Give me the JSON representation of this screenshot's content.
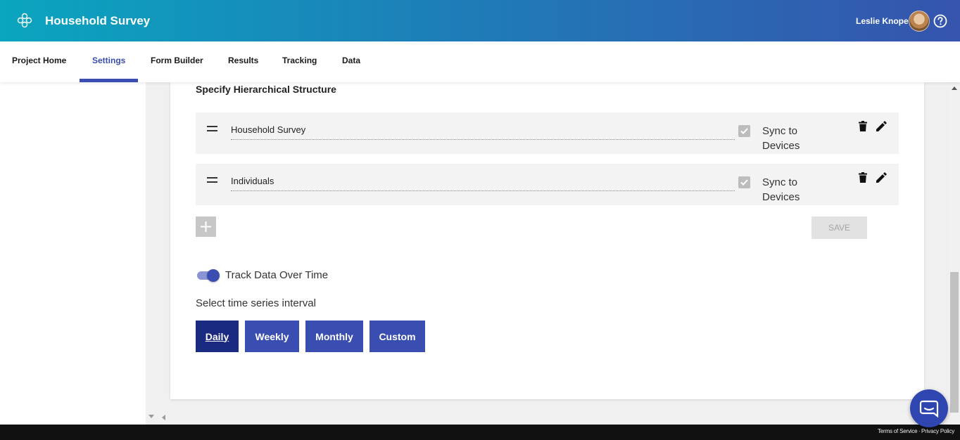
{
  "header": {
    "app_title": "Household Survey",
    "user_name": "Leslie Knope",
    "logo_icon": "flower-logo-icon",
    "help_icon": "question-circle-icon"
  },
  "nav": {
    "tabs": [
      {
        "label": "Project Home",
        "active": false
      },
      {
        "label": "Settings",
        "active": true
      },
      {
        "label": "Form Builder",
        "active": false
      },
      {
        "label": "Results",
        "active": false
      },
      {
        "label": "Tracking",
        "active": false
      },
      {
        "label": "Data",
        "active": false
      }
    ]
  },
  "hierarchy": {
    "title": "Specify Hierarchical Structure",
    "rows": [
      {
        "name": "Household Survey",
        "sync_label": "Sync to Devices",
        "sync_checked": true
      },
      {
        "name": "Individuals",
        "sync_label": "Sync to Devices",
        "sync_checked": true
      }
    ],
    "add_label": "+",
    "save_label": "SAVE"
  },
  "tracking": {
    "toggle_label": "Track Data Over Time",
    "toggle_on": true,
    "interval_label": "Select time series interval",
    "intervals": [
      {
        "label": "Daily",
        "selected": true
      },
      {
        "label": "Weekly",
        "selected": false
      },
      {
        "label": "Monthly",
        "selected": false
      },
      {
        "label": "Custom",
        "selected": false
      }
    ]
  },
  "footer": {
    "terms": "Terms of Service",
    "separator": "·",
    "privacy": "Privacy Policy"
  },
  "colors": {
    "accent": "#3a4db0",
    "selected_interval": "#1a2a80",
    "header_start": "#0aa5bf",
    "header_end": "#3654ad"
  }
}
